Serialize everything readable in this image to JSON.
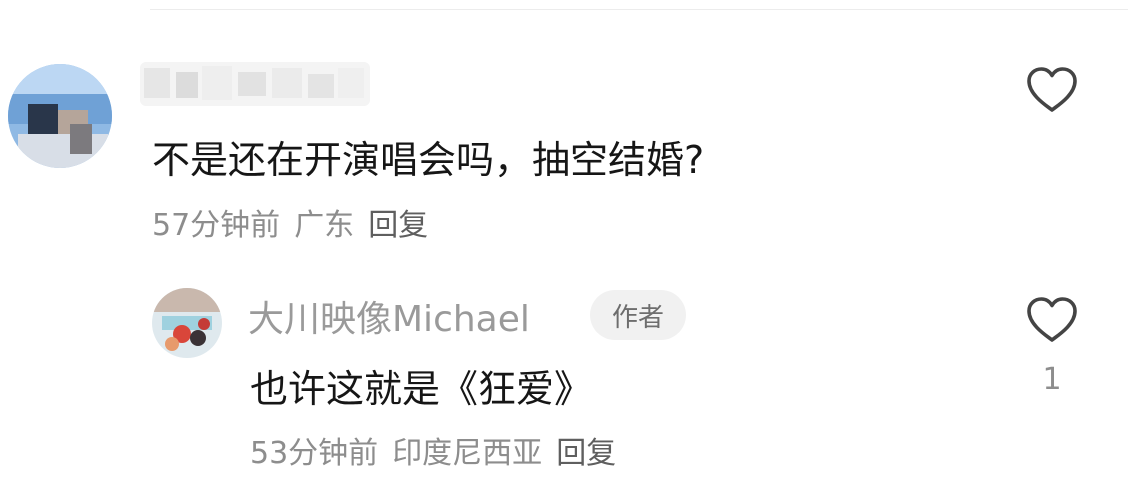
{
  "comment": {
    "text": "不是还在开演唱会吗，抽空结婚?",
    "time": "57分钟前",
    "location": "广东",
    "reply_label": "回复",
    "like_icon": "heart-icon"
  },
  "reply": {
    "username": "大川映像Michael",
    "badge": "作者",
    "text": "也许这就是《狂爱》",
    "time": "53分钟前",
    "location": "印度尼西亚",
    "reply_label": "回复",
    "like_icon": "heart-icon",
    "like_count": "1"
  },
  "colors": {
    "text": "#161616",
    "meta": "#8d8d8d",
    "badge_bg": "#f1f1f1"
  }
}
